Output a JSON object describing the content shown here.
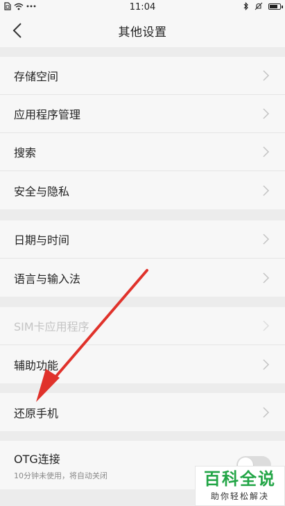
{
  "status_bar": {
    "time": "11:04",
    "left_icons": [
      "sim-icon",
      "wifi-icon",
      "more-dots-icon"
    ],
    "right_icons": [
      "bluetooth-icon",
      "mute-icon",
      "battery-icon"
    ],
    "battery_level": 0.85
  },
  "header": {
    "title": "其他设置",
    "back_icon": "back-chevron-icon"
  },
  "groups": [
    {
      "items": [
        {
          "label": "存储空间"
        },
        {
          "label": "应用程序管理"
        },
        {
          "label": "搜索"
        },
        {
          "label": "安全与隐私"
        }
      ]
    },
    {
      "items": [
        {
          "label": "日期与时间"
        },
        {
          "label": "语言与输入法"
        }
      ]
    },
    {
      "items": [
        {
          "label": "SIM卡应用程序",
          "disabled": true
        },
        {
          "label": "辅助功能"
        }
      ]
    },
    {
      "items": [
        {
          "label": "还原手机"
        }
      ]
    },
    {
      "items": [
        {
          "label": "OTG连接",
          "sublabel": "10分钟未使用，将自动关闭",
          "toggle": false
        }
      ]
    }
  ],
  "annotation": {
    "type": "red-arrow",
    "color": "#e0322b",
    "points_to": "还原手机"
  },
  "watermark": {
    "main": "百科全说",
    "sub": "助你轻松解决",
    "color": "#22a546"
  }
}
